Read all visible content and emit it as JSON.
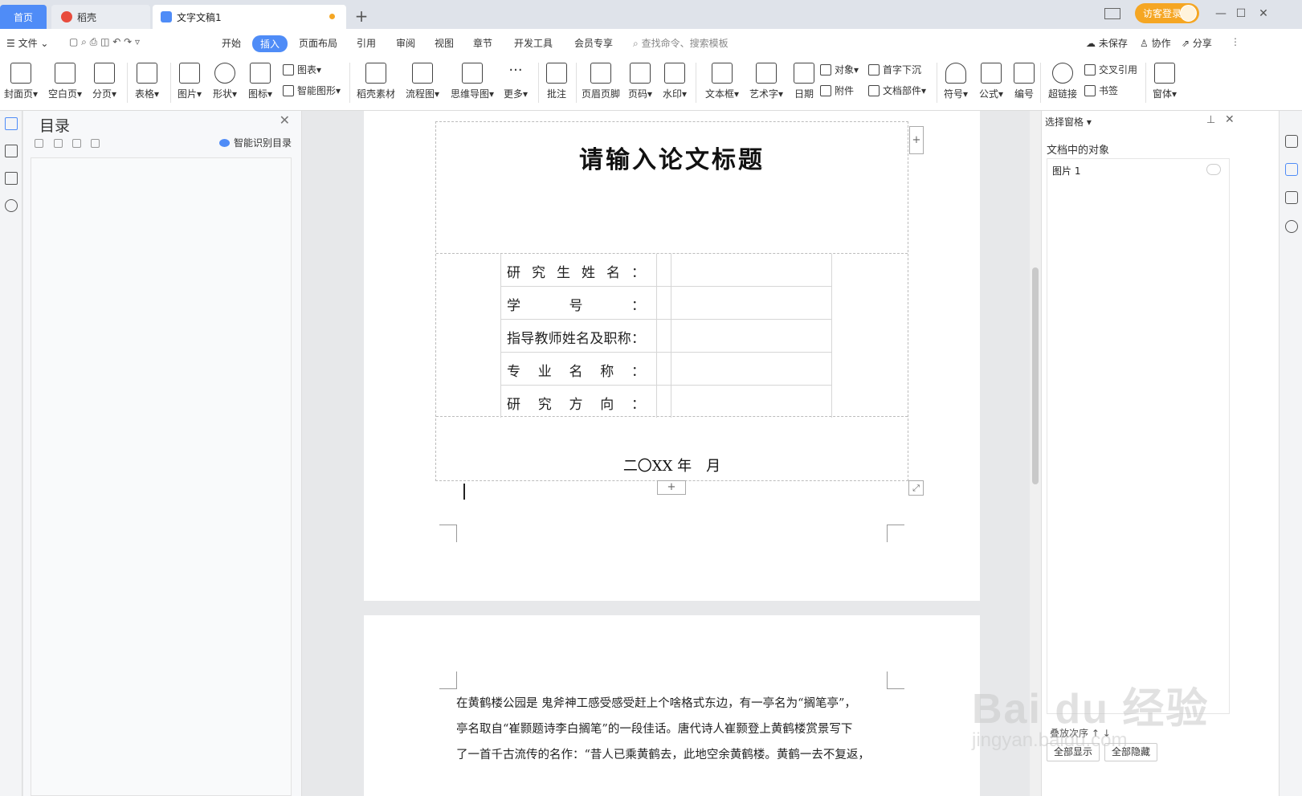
{
  "tabs": {
    "home": "首页",
    "daoke": "稻壳",
    "doc": "文字文稿1"
  },
  "titlebar": {
    "login": "访客登录"
  },
  "menu": {
    "file": "文件",
    "items": [
      "开始",
      "插入",
      "页面布局",
      "引用",
      "审阅",
      "视图",
      "章节",
      "开发工具",
      "会员专享"
    ],
    "search": "查找命令、搜索模板",
    "unsaved": "未保存",
    "collab": "协作",
    "share": "分享"
  },
  "ribbon": {
    "cover": "封面页",
    "blank": "空白页",
    "pagebreak": "分页",
    "table": "表格",
    "picture": "图片",
    "shape": "形状",
    "icons": "图标",
    "chart": "图表",
    "smartart": "智能图形",
    "material": "稻壳素材",
    "flowchart": "流程图",
    "mindmap": "思维导图",
    "more": "更多",
    "comment": "批注",
    "headerfooter": "页眉页脚",
    "pagenum": "页码",
    "watermark": "水印",
    "textbox": "文本框",
    "wordart": "艺术字",
    "date": "日期",
    "object": "对象",
    "attach": "附件",
    "dropcap": "首字下沉",
    "docpart": "文档部件",
    "symbol": "符号",
    "formula": "公式",
    "numbering": "编号",
    "hyperlink": "超链接",
    "crossref": "交叉引用",
    "bookmark": "书签",
    "window": "窗体"
  },
  "toc": {
    "title": "目录",
    "smart": "智能识别目录"
  },
  "doc": {
    "title": "请输入论文标题",
    "fields": [
      "研究生姓名：",
      "学号：",
      "指导教师姓名及职称：",
      "专业名称：",
      "研究方向："
    ],
    "date": "二〇XX 年　月",
    "paragraph": [
      "在黄鹤楼公园是 鬼斧神工感受感受赶上个啥格式东边，有一亭名为“搁笔亭”，",
      "亭名取自“崔颢题诗李白搁笔”的一段佳话。唐代诗人崔颢登上黄鹤楼赏景写下",
      "了一首千古流传的名作：“昔人已乘黄鹤去，此地空余黄鹤楼。黄鹤一去不复返，"
    ]
  },
  "selpane": {
    "header": "选择窗格",
    "subtitle": "文档中的对象",
    "item": "图片 1",
    "order": "叠放次序",
    "showall": "全部显示",
    "hideall": "全部隐藏"
  },
  "watermark": {
    "main": "Bai du 经验",
    "sub": "jingyan.baidu.com"
  },
  "colors": {
    "accent": "#4f8cf7",
    "login": "#f5a623",
    "page": "#ffffff",
    "canvas": "#e7e8ea"
  }
}
